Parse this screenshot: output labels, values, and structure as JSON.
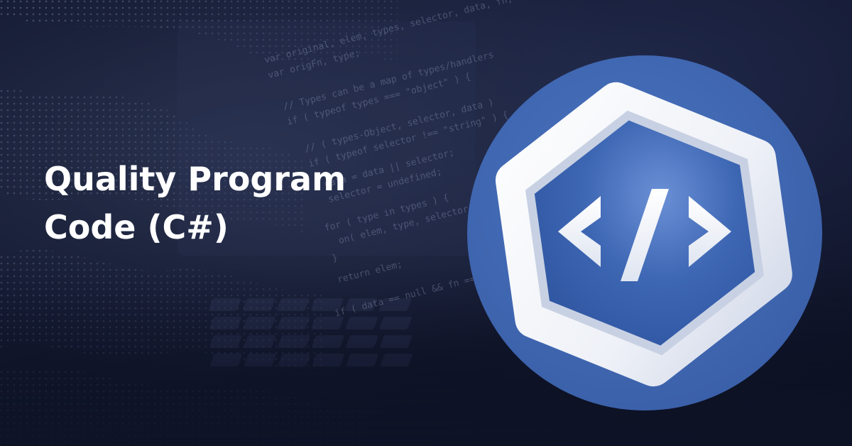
{
  "headline": {
    "line1": "Quality Program",
    "line2": "Code (C#)"
  },
  "badge": {
    "icon": "code-brackets-icon",
    "circle_color": "#3f67b1",
    "hex_color": "#f2f4f8",
    "inner_color": "#3b63b0"
  },
  "background": {
    "code_snippet": [
      "var original, elem, types, selector, data, fn, one ) {",
      "var origFn, type;",
      "// Types can be a map of types/handlers",
      "if ( typeof types === \"object\" ) {",
      "// ( types-Object, selector, data )",
      "if ( typeof selector !== \"string\" ) {",
      "data = data || selector;",
      "selector = undefined;",
      "for ( type in types ) {",
      "on( elem, type, selector, data, types[ type ], one );",
      "}",
      "return elem;",
      "if ( data == null && fn == null ) {"
    ]
  }
}
